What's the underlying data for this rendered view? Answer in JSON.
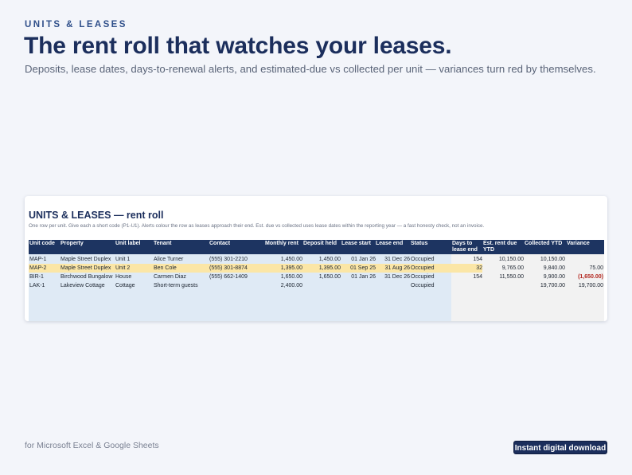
{
  "hero": {
    "eyebrow": "UNITS & LEASES",
    "headline": "The rent roll that watches your leases.",
    "subline": "Deposits, lease dates, days-to-renewal alerts, and estimated-due vs collected per unit — variances turn red by themselves."
  },
  "sheet": {
    "title": "UNITS & LEASES — rent roll",
    "note": "One row per unit. Give each a short code (P1-U1). Alerts colour the row as leases approach their end. Est. due vs collected uses lease dates within the reporting year — a fast honesty check, not an invoice.",
    "columns": {
      "unit_code": "Unit code",
      "property": "Property",
      "unit_label": "Unit label",
      "tenant": "Tenant",
      "contact": "Contact",
      "monthly_rent": "Monthly rent",
      "deposit_held": "Deposit held",
      "lease_start": "Lease start",
      "lease_end": "Lease end",
      "status": "Status",
      "days_to_end_1": "Days to",
      "days_to_end_2": "lease end",
      "est_due_1": "Est. rent due",
      "est_due_2": "YTD",
      "collected": "Collected YTD",
      "variance": "Variance"
    },
    "rows": [
      {
        "code": "MAP-1",
        "property": "Maple Street Duplex",
        "unit": "Unit 1",
        "tenant": "Alice Turner",
        "contact": "(555) 301-2210",
        "rent": "1,450.00",
        "deposit": "1,450.00",
        "start": "01 Jan 26",
        "end": "31 Dec 26",
        "status": "Occupied",
        "days": "154",
        "due": "10,150.00",
        "collected": "10,150.00",
        "variance": ""
      },
      {
        "code": "MAP-2",
        "property": "Maple Street Duplex",
        "unit": "Unit 2",
        "tenant": "Ben Cole",
        "contact": "(555) 301-8874",
        "rent": "1,395.00",
        "deposit": "1,395.00",
        "start": "01 Sep 25",
        "end": "31 Aug 26",
        "status": "Occupied",
        "days": "32",
        "due": "9,765.00",
        "collected": "9,840.00",
        "variance": "75.00"
      },
      {
        "code": "BIR-1",
        "property": "Birchwood Bungalow",
        "unit": "House",
        "tenant": "Carmen Diaz",
        "contact": "(555) 662-1409",
        "rent": "1,650.00",
        "deposit": "1,650.00",
        "start": "01 Jan 26",
        "end": "31 Dec 26",
        "status": "Occupied",
        "days": "154",
        "due": "11,550.00",
        "collected": "9,900.00",
        "variance": "(1,650.00)"
      },
      {
        "code": "LAK-1",
        "property": "Lakeview Cottage",
        "unit": "Cottage",
        "tenant": "Short-term guests",
        "contact": "",
        "rent": "2,400.00",
        "deposit": "",
        "start": "",
        "end": "",
        "status": "Occupied",
        "days": "",
        "due": "",
        "collected": "19,700.00",
        "variance": "19,700.00"
      }
    ]
  },
  "footer": {
    "compat": "for Microsoft Excel & Google Sheets",
    "badge": "Instant digital download"
  },
  "colors": {
    "navy": "#1b2e5c",
    "header_bg": "#1d3461",
    "highlight_row": "#fbe6a6",
    "input_area": "#dfeaf5",
    "calc_area": "#f2f2f2",
    "negative": "#b3261e"
  }
}
